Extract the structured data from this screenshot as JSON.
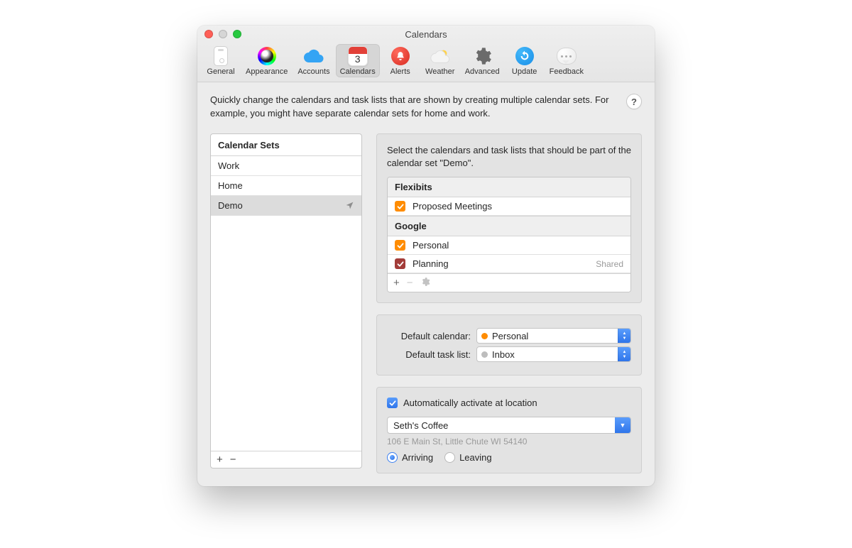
{
  "window": {
    "title": "Calendars"
  },
  "toolbar": {
    "items": [
      {
        "id": "general",
        "label": "General"
      },
      {
        "id": "appearance",
        "label": "Appearance"
      },
      {
        "id": "accounts",
        "label": "Accounts"
      },
      {
        "id": "calendars",
        "label": "Calendars",
        "selected": true,
        "cal_day": "3"
      },
      {
        "id": "alerts",
        "label": "Alerts"
      },
      {
        "id": "weather",
        "label": "Weather"
      },
      {
        "id": "advanced",
        "label": "Advanced"
      },
      {
        "id": "update",
        "label": "Update"
      },
      {
        "id": "feedback",
        "label": "Feedback"
      }
    ]
  },
  "intro": "Quickly change the calendars and task lists that are shown by creating multiple calendar sets. For example, you might have separate calendar sets for home and work.",
  "help": "?",
  "sets": {
    "header": "Calendar Sets",
    "items": [
      {
        "name": "Work"
      },
      {
        "name": "Home"
      },
      {
        "name": "Demo",
        "selected": true,
        "location": true
      }
    ],
    "footer": {
      "add": "+",
      "remove": "−"
    }
  },
  "right": {
    "desc": "Select the calendars and task lists that should be part of the calendar set \"Demo\".",
    "sections": [
      {
        "title": "Flexibits",
        "rows": [
          {
            "name": "Proposed Meetings",
            "color": "#ff8c00",
            "checked": true
          }
        ]
      },
      {
        "title": "Google",
        "rows": [
          {
            "name": "Personal",
            "color": "#ff8c00",
            "checked": true
          },
          {
            "name": "Planning",
            "color": "#a33c39",
            "checked": true,
            "tag": "Shared"
          }
        ]
      }
    ],
    "table_footer": {
      "add": "+",
      "remove": "−",
      "settings": "gear"
    }
  },
  "defaults": {
    "calendar": {
      "label": "Default calendar:",
      "value": "Personal",
      "dot": "#ff8c00"
    },
    "tasklist": {
      "label": "Default task list:",
      "value": "Inbox",
      "dot": "#bdbdbd"
    }
  },
  "location": {
    "auto_label": "Automatically activate at location",
    "auto_checked": true,
    "place": "Seth's Coffee",
    "address": "106 E Main St, Little Chute WI 54140",
    "radio": {
      "arriving": "Arriving",
      "leaving": "Leaving",
      "value": "arriving"
    }
  }
}
